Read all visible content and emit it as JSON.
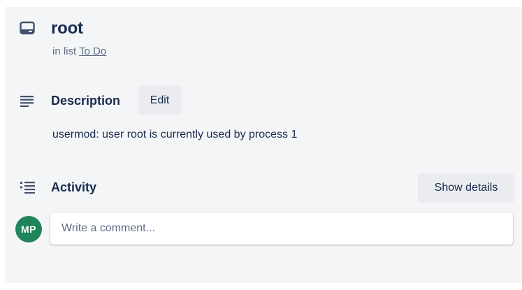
{
  "card": {
    "title": "root",
    "in_list_prefix": "in list",
    "list_name": "To Do",
    "icon": "card-icon"
  },
  "description": {
    "heading": "Description",
    "edit_label": "Edit",
    "text": "usermod: user root is currently used by process 1",
    "icon": "description-lines-icon"
  },
  "activity": {
    "heading": "Activity",
    "show_details_label": "Show details",
    "icon": "activity-list-icon"
  },
  "comment": {
    "avatar_initials": "MP",
    "avatar_color": "#1f845a",
    "placeholder": "Write a comment..."
  },
  "colors": {
    "panel_bg": "#f4f5f7",
    "button_bg": "#ebecf0",
    "text_primary": "#172b4d",
    "text_secondary": "#5e6c84"
  }
}
